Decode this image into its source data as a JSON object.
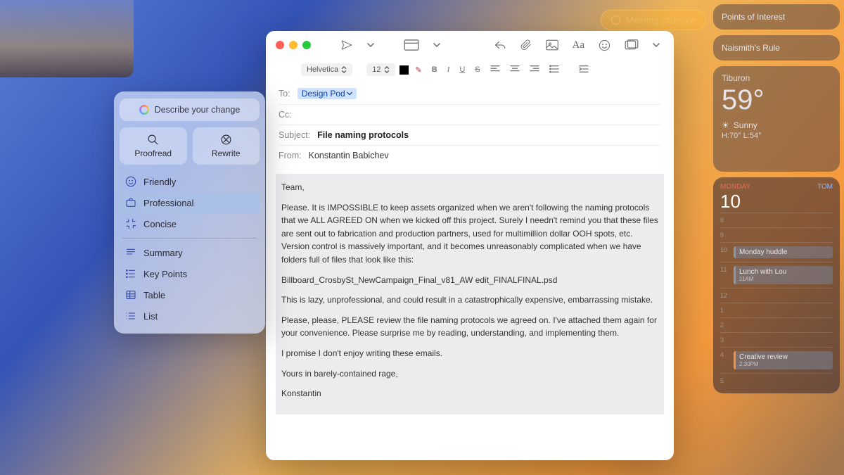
{
  "meeting_pill": "Meeting cadence",
  "widgets": {
    "poi": "Points of Interest",
    "rule": "Naismith's Rule",
    "weather": {
      "location": "Tiburon",
      "temp": "59°",
      "cond": "Sunny",
      "range": "H:70° L:54°"
    },
    "calendar": {
      "dow": "MONDAY",
      "day": "10",
      "other": "TOM",
      "events": [
        {
          "h": "10",
          "title": "Monday huddle",
          "sub": ""
        },
        {
          "h": "11",
          "title": "Lunch with Lou",
          "sub": "11AM"
        },
        {
          "h": "4",
          "title": "Creative review",
          "sub": "2:30PM"
        }
      ]
    }
  },
  "write_panel": {
    "describe": "Describe your change",
    "proofread": "Proofread",
    "rewrite": "Rewrite",
    "tones": [
      "Friendly",
      "Professional",
      "Concise"
    ],
    "formats": [
      "Summary",
      "Key Points",
      "Table",
      "List"
    ],
    "selected": "Professional"
  },
  "mail": {
    "font": "Helvetica",
    "size": "12",
    "to_label": "To:",
    "to_token": "Design Pod",
    "cc_label": "Cc:",
    "subject_label": "Subject:",
    "subject": "File naming protocols",
    "from_label": "From:",
    "from": "Konstantin Babichev",
    "body": {
      "p1": "Team,",
      "p2": "Please. It is IMPOSSIBLE to keep assets organized when we aren't following the naming protocols that we ALL AGREED ON when we kicked off this project. Surely I needn't remind you that these files are sent out to fabrication and production partners, used for multimillion dollar OOH spots, etc. Version control is massively important, and it becomes unreasonably complicated when we have folders full of files that look like this:",
      "p3": "Billboard_CrosbySt_NewCampaign_Final_v81_AW edit_FINALFINAL.psd",
      "p4": "This is lazy, unprofessional, and could result in a catastrophically expensive, embarrassing mistake.",
      "p5": "Please, please, PLEASE review the file naming protocols we agreed on. I've attached them again for your convenience. Please surprise me by reading, understanding, and implementing them.",
      "p6": "I promise I don't enjoy writing these emails.",
      "p7": "Yours in barely-contained rage,",
      "p8": "Konstantin"
    }
  }
}
